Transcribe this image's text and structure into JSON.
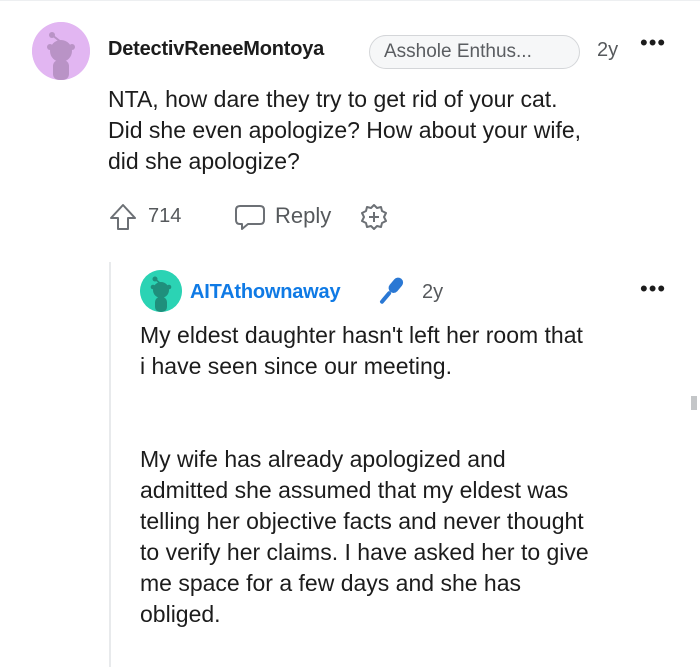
{
  "comment": {
    "username": "DetectivReneeMontoya",
    "flair": "Asshole Enthus...",
    "age": "2y",
    "more": "•••",
    "body": [
      "NTA, how dare they try to get rid of your cat.",
      "Did she even apologize? How about your wife,",
      "did she apologize?"
    ],
    "votes": "714",
    "reply_label": "Reply",
    "icons": {
      "avatar": "reddit-snoo-avatar-icon",
      "upvote": "upvote-arrow-icon",
      "reply": "speech-bubble-icon",
      "award": "award-plus-icon"
    },
    "avatar_color": "#e2b6f2"
  },
  "reply": {
    "username": "AITAthownaway",
    "age": "2y",
    "more": "•••",
    "paragraphs": [
      [
        "My eldest daughter hasn't left her room that",
        "i have seen since our meeting."
      ],
      [
        "My wife has already apologized and",
        "admitted she assumed that my eldest was",
        "telling her objective facts and never thought",
        "to verify her claims. I have asked her to give",
        "me space for a few days and she has",
        "obliged."
      ]
    ],
    "icons": {
      "avatar": "reddit-snoo-avatar-icon",
      "op_badge": "microphone-icon"
    },
    "username_color": "#0f7ae5",
    "avatar_color": "#2bd3b4"
  }
}
